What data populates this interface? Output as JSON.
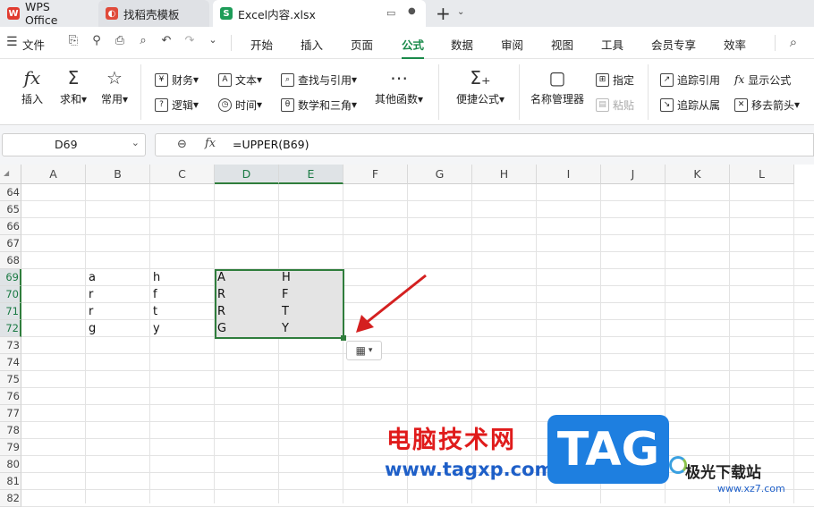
{
  "titlebar": {
    "tabs": [
      {
        "label": "WPS Office"
      },
      {
        "label": "找稻壳模板"
      },
      {
        "label": "Excel内容.xlsx"
      }
    ],
    "new_tab": "+"
  },
  "menubar": {
    "file_label": "文件",
    "items": [
      "开始",
      "插入",
      "页面",
      "公式",
      "数据",
      "审阅",
      "视图",
      "工具",
      "会员专享",
      "效率"
    ],
    "active": "公式"
  },
  "ribbon": {
    "insert": "插入",
    "sum": "求和",
    "common": "常用",
    "finance": "财务",
    "text": "文本",
    "lookup": "查找与引用",
    "logic": "逻辑",
    "time": "时间",
    "math": "数学和三角",
    "other": "其他函数",
    "quick": "便捷公式",
    "name_mgr": "名称管理器",
    "specify": "指定",
    "paste": "粘贴",
    "trace_prec": "追踪引用",
    "trace_dep": "追踪从属",
    "show_formula": "显示公式",
    "remove_arrows": "移去箭头"
  },
  "formulabar": {
    "cell_ref": "D69",
    "formula": "=UPPER(B69)"
  },
  "sheet": {
    "columns": [
      "A",
      "B",
      "C",
      "D",
      "E",
      "F",
      "G",
      "H",
      "I",
      "J",
      "K",
      "L"
    ],
    "selected_columns": [
      "D",
      "E"
    ],
    "rows": [
      "64",
      "65",
      "66",
      "67",
      "68",
      "69",
      "70",
      "71",
      "72",
      "73",
      "74",
      "75",
      "76",
      "77",
      "78",
      "79",
      "80",
      "81",
      "82"
    ],
    "selected_rows": [
      "69",
      "70",
      "71",
      "72"
    ],
    "cells": [
      {
        "col": "B",
        "row": "69",
        "value": "a"
      },
      {
        "col": "C",
        "row": "69",
        "value": "h"
      },
      {
        "col": "D",
        "row": "69",
        "value": "A"
      },
      {
        "col": "E",
        "row": "69",
        "value": "H"
      },
      {
        "col": "B",
        "row": "70",
        "value": "r"
      },
      {
        "col": "C",
        "row": "70",
        "value": "f"
      },
      {
        "col": "D",
        "row": "70",
        "value": "R"
      },
      {
        "col": "E",
        "row": "70",
        "value": "F"
      },
      {
        "col": "B",
        "row": "71",
        "value": "r"
      },
      {
        "col": "C",
        "row": "71",
        "value": "t"
      },
      {
        "col": "D",
        "row": "71",
        "value": "R"
      },
      {
        "col": "E",
        "row": "71",
        "value": "T"
      },
      {
        "col": "B",
        "row": "72",
        "value": "g"
      },
      {
        "col": "C",
        "row": "72",
        "value": "y"
      },
      {
        "col": "D",
        "row": "72",
        "value": "G"
      },
      {
        "col": "E",
        "row": "72",
        "value": "Y"
      }
    ]
  },
  "watermark": {
    "site_cn": "电脑技术网",
    "site_url": "www.tagxp.com",
    "tag": "TAG",
    "brand_cn": "极光下载站",
    "brand_url": "www.xz7.com"
  },
  "colors": {
    "accent": "#1a8a4a",
    "selection": "#2f7d3c",
    "arrow": "#d42020"
  }
}
